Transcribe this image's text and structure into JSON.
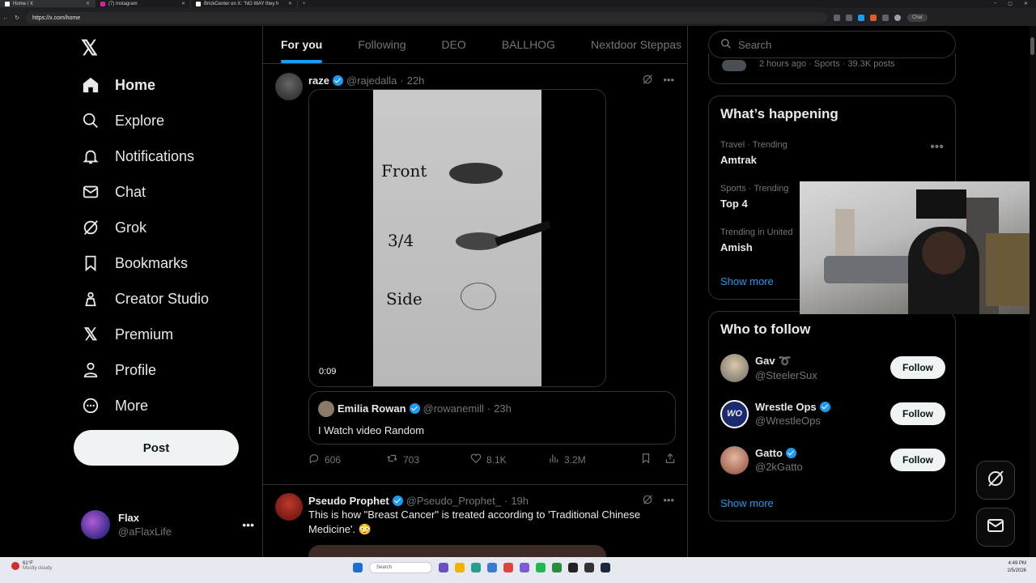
{
  "browser": {
    "tabs": [
      {
        "label": "Home / X",
        "active": true
      },
      {
        "label": "(7) Instagram",
        "active": false
      },
      {
        "label": "BrickCenter on X: \"NO WAY they h",
        "active": false
      }
    ],
    "url": "https://x.com/home",
    "chat_chip": "Chat"
  },
  "sidebar": {
    "items": [
      {
        "label": "Home",
        "icon": "home-icon"
      },
      {
        "label": "Explore",
        "icon": "search-icon"
      },
      {
        "label": "Notifications",
        "icon": "bell-icon"
      },
      {
        "label": "Chat",
        "icon": "mail-icon"
      },
      {
        "label": "Grok",
        "icon": "grok-icon"
      },
      {
        "label": "Bookmarks",
        "icon": "bookmark-icon"
      },
      {
        "label": "Creator Studio",
        "icon": "creator-studio-icon"
      },
      {
        "label": "Premium",
        "icon": "x-logo-icon"
      },
      {
        "label": "Profile",
        "icon": "person-icon"
      },
      {
        "label": "More",
        "icon": "more-circle-icon"
      }
    ],
    "post_label": "Post",
    "account": {
      "name": "Flax",
      "handle": "@aFlaxLife"
    }
  },
  "feed": {
    "tabs": [
      "For you",
      "Following",
      "DEO",
      "BALLHOG",
      "Nextdoor Steppas"
    ],
    "tweet1": {
      "name": "raze",
      "handle": "@rajedalla",
      "time": "22h",
      "video_labels": [
        "Front",
        "3/4",
        "Side"
      ],
      "duration": "0:09",
      "quote": {
        "name": "Emilia Rowan",
        "handle": "@rowanemill",
        "time": "23h",
        "text": "I Watch video Random"
      },
      "replies": "606",
      "reposts": "703",
      "likes": "8.1K",
      "views": "3.2M"
    },
    "tweet2": {
      "name": "Pseudo Prophet",
      "handle": "@Pseudo_Prophet_",
      "time": "19h",
      "text": "This is how \"Breast Cancer\" is treated according to 'Traditional Chinese Medicine'. 😳"
    },
    "dot": "·"
  },
  "right": {
    "search_placeholder": "Search",
    "prev_trend_text": "2 hours ago · Sports · 39.3K posts",
    "happening": {
      "title": "What’s happening",
      "trends": [
        {
          "category": "Travel · Trending",
          "name": "Amtrak"
        },
        {
          "category": "Sports · Trending",
          "name": "Top 4"
        },
        {
          "category": "Trending in United",
          "name": "Amish"
        }
      ],
      "show_more": "Show more"
    },
    "who_to_follow": {
      "title": "Who to follow",
      "accounts": [
        {
          "name": "Gav",
          "handle": "@SteelerSux",
          "verified": false,
          "button": "Follow"
        },
        {
          "name": "Wrestle Ops",
          "handle": "@WrestleOps",
          "verified": true,
          "button": "Follow"
        },
        {
          "name": "Gatto",
          "handle": "@2kGatto",
          "verified": true,
          "button": "Follow"
        }
      ],
      "show_more": "Show more"
    }
  },
  "taskbar": {
    "weather_temp": "61°F",
    "weather_desc": "Mostly cloudy",
    "search_placeholder": "Search",
    "time": "4:49 PM",
    "date": "2/5/2026"
  },
  "colors": {
    "accent": "#1d9bf0",
    "background": "#000000",
    "border": "#2f3336",
    "muted": "#71767b"
  }
}
